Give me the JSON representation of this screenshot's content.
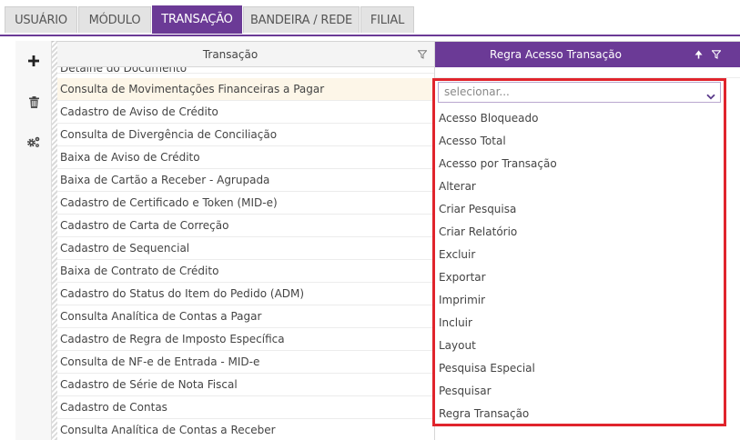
{
  "tabs": [
    {
      "label": "USUÁRIO",
      "active": false
    },
    {
      "label": "MÓDULO",
      "active": false
    },
    {
      "label": "TRANSAÇÃO",
      "active": true
    },
    {
      "label": "BANDEIRA / REDE",
      "active": false
    },
    {
      "label": "FILIAL",
      "active": false
    }
  ],
  "toolbar": {
    "add_icon": "plus-icon",
    "delete_icon": "trash-icon",
    "settings_icon": "gears-icon"
  },
  "grid": {
    "col_transacao": "Transação",
    "col_regra": "Regra Acesso Transação",
    "rows": [
      "Detalhe do Documento",
      "Consulta de Movimentações Financeiras a Pagar",
      "Cadastro de Aviso de Crédito",
      "Consulta de Divergência de Conciliação",
      "Baixa de Aviso de Crédito",
      "Baixa de Cartão a Receber - Agrupada",
      "Cadastro de Certificado e Token (MID-e)",
      "Cadastro de Carta de Correção",
      "Cadastro de Sequencial",
      "Baixa de Contrato de Crédito",
      "Cadastro do Status do Item do Pedido (ADM)",
      "Consulta Analítica de Contas a Pagar",
      "Cadastro de Regra de Imposto Específica",
      "Consulta de NF-e de Entrada - MID-e",
      "Cadastro de Série de Nota Fiscal",
      "Cadastro de Contas",
      "Consulta Analítica de Contas a Receber"
    ],
    "selected_row": 1
  },
  "dropdown": {
    "placeholder": "selecionar...",
    "options": [
      "Acesso Bloqueado",
      "Acesso Total",
      "Acesso por Transação",
      "Alterar",
      "Criar Pesquisa",
      "Criar Relatório",
      "Excluir",
      "Exportar",
      "Imprimir",
      "Incluir",
      "Layout",
      "Pesquisa Especial",
      "Pesquisar",
      "Regra Transação"
    ]
  },
  "colors": {
    "accent": "#6b3a96",
    "highlight": "#e0242c",
    "selected_row": "#fdf6e8"
  }
}
